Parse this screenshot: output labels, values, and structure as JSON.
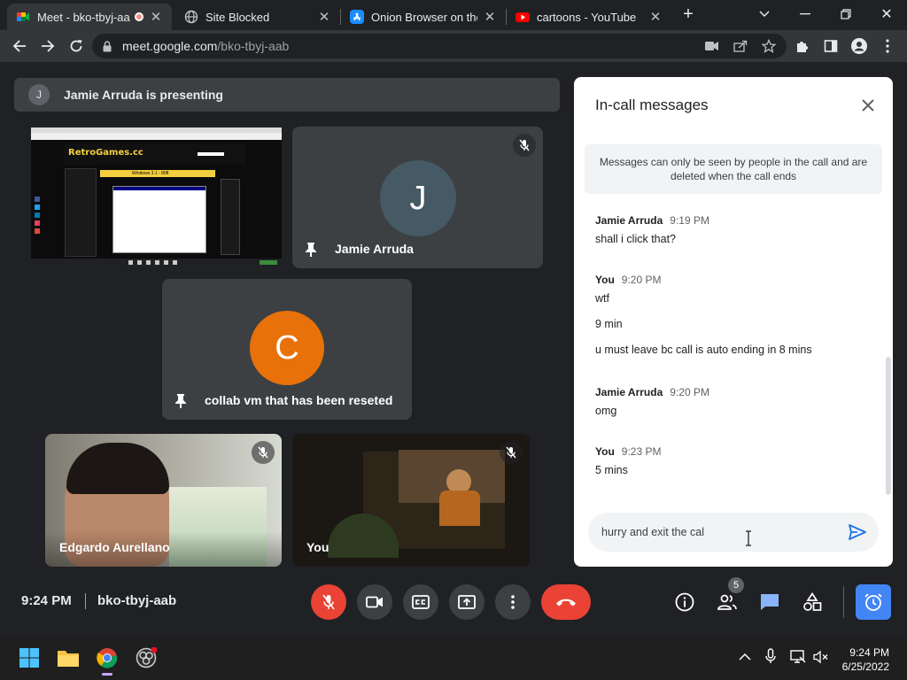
{
  "browser": {
    "tabs": [
      {
        "title": "Meet - bko-tbyj-aa",
        "favicon": "google-meet-icon",
        "active": true
      },
      {
        "title": "Site Blocked",
        "favicon": "globe-icon",
        "active": false
      },
      {
        "title": "Onion Browser on the",
        "favicon": "app-store-icon",
        "active": false
      },
      {
        "title": "cartoons - YouTube",
        "favicon": "youtube-icon",
        "active": false
      }
    ],
    "url_host": "meet.google.com",
    "url_path": "/bko-tbyj-aab"
  },
  "meet": {
    "presenting_banner": {
      "initial": "J",
      "text": "Jamie Arruda is presenting"
    },
    "tiles": [
      {
        "name": "Jamie Arruda",
        "initial": "J",
        "avatar_color": "#455a64"
      },
      {
        "name": "collab vm that has been reseted",
        "initial": "C",
        "avatar_color": "#e8710a"
      },
      {
        "name": "Edgardo Aurellano"
      },
      {
        "name": "You"
      }
    ],
    "shared_screen": {
      "logo": "RetroGames.cc",
      "heading": "Windows 3.1 - 808"
    },
    "chat": {
      "title": "In-call messages",
      "notice": "Messages can only be seen by people in the call and are deleted when the call ends",
      "groups": [
        {
          "sender": "Jamie Arruda",
          "time": "9:19 PM",
          "messages": [
            "shall i click  that?"
          ]
        },
        {
          "sender": "You",
          "time": "9:20 PM",
          "messages": [
            "wtf",
            "9 min",
            "u must leave bc call is auto ending in 8 mins"
          ]
        },
        {
          "sender": "Jamie Arruda",
          "time": "9:20 PM",
          "messages": [
            "omg"
          ]
        },
        {
          "sender": "You",
          "time": "9:23 PM",
          "messages": [
            "5 mins"
          ]
        }
      ],
      "compose_value": "hurry and exit the cal"
    },
    "bottom_bar": {
      "time": "9:24 PM",
      "meeting_code": "bko-tbyj-aab",
      "participants_count": "5"
    },
    "colors": {
      "end_call": "#ea4335",
      "accent": "#4285f4",
      "tile_bg": "#3c4043"
    }
  },
  "taskbar": {
    "time": "9:24 PM",
    "date": "6/25/2022"
  }
}
